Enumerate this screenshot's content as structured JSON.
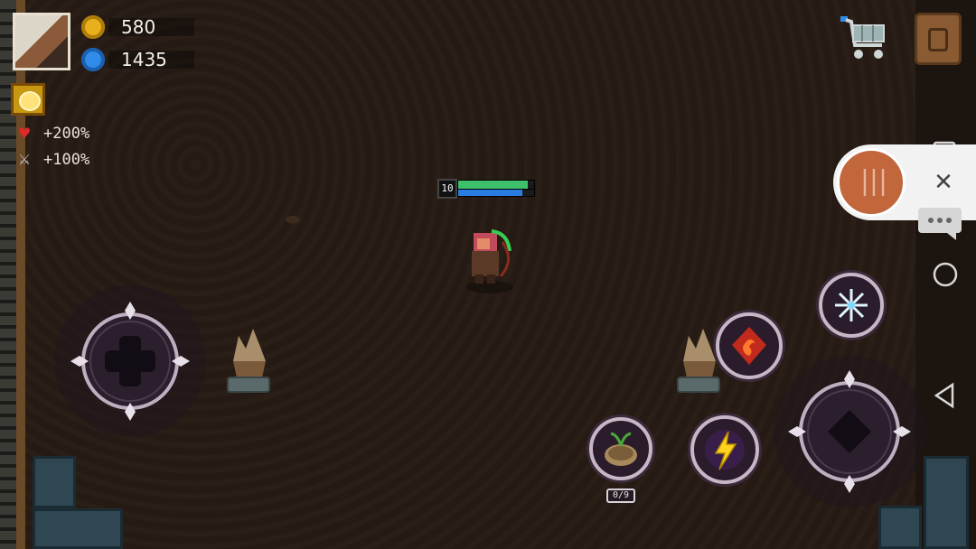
{
  "hud": {
    "gold": "580",
    "gems": "1435",
    "buffs": [
      {
        "icon": "heart-buff-icon",
        "value": "+200%"
      },
      {
        "icon": "sword-buff-icon",
        "value": "+100%"
      }
    ]
  },
  "player": {
    "level": "10",
    "hp_fraction": 0.92,
    "mp_fraction": 0.85
  },
  "skills": {
    "seed_count": "0/9"
  },
  "icons": {
    "gold": "gold-coin-icon",
    "gems": "blue-gem-icon",
    "shop": "shopping-cart-icon",
    "backpack": "backpack-icon",
    "skill_freeze": "snowflake-icon",
    "skill_fire": "fire-rune-icon",
    "skill_lightning": "lightning-icon",
    "skill_seed": "seed-pot-icon"
  },
  "colors": {
    "gold": "#e8b11c",
    "gem": "#2f8ce8",
    "hp": "#3ec06a",
    "mp": "#2a7de0",
    "overlay_accent": "#c2663c"
  }
}
